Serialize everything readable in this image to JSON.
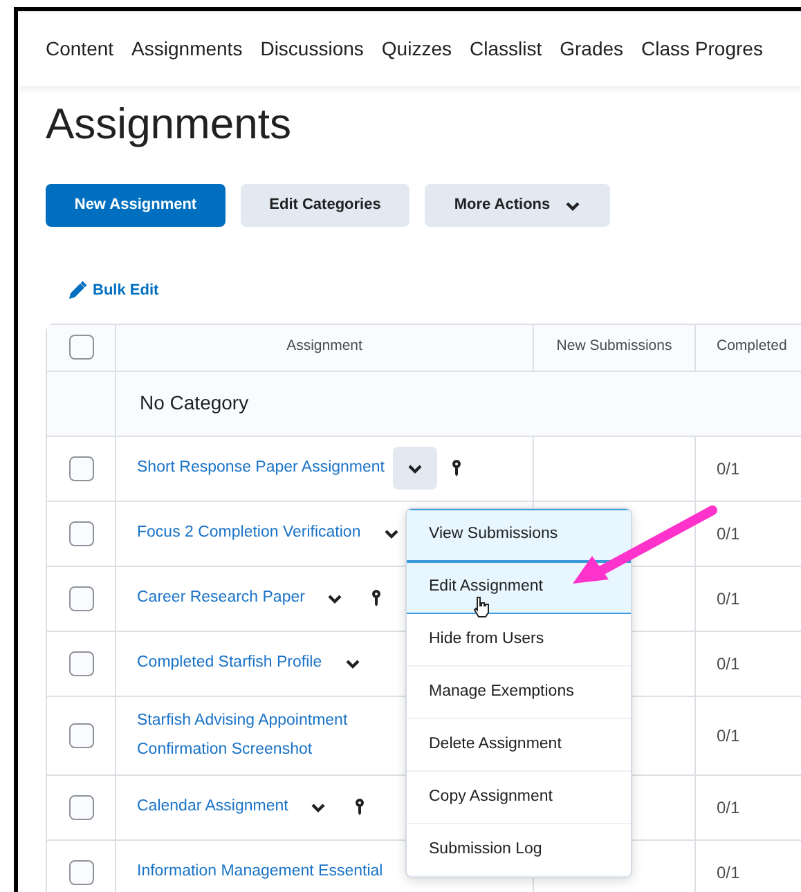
{
  "nav": {
    "items": [
      "Content",
      "Assignments",
      "Discussions",
      "Quizzes",
      "Classlist",
      "Grades",
      "Class Progres"
    ]
  },
  "title": "Assignments",
  "actions": [
    {
      "label": "New Assignment",
      "kind": "primary"
    },
    {
      "label": "Edit Categories",
      "kind": "secondary"
    },
    {
      "label": "More Actions",
      "kind": "dropdown"
    }
  ],
  "bulk_edit": "Bulk Edit",
  "table": {
    "columns": [
      "Assignment",
      "New Submissions",
      "Completed"
    ],
    "header_checked": false,
    "category": "No Category",
    "rows": [
      {
        "name": "Short Response Paper Assignment",
        "completed": "0/1",
        "checked": false,
        "menu_button": true,
        "expanded": true,
        "key": true
      },
      {
        "name": "Focus 2 Completion Verification",
        "completed": "0/1",
        "checked": false,
        "menu_button": true,
        "expanded": false,
        "key": false
      },
      {
        "name": "Career Research Paper",
        "completed": "0/1",
        "checked": false,
        "menu_button": true,
        "expanded": false,
        "key": true
      },
      {
        "name": "Completed Starfish Profile",
        "completed": "0/1",
        "checked": false,
        "menu_button": true,
        "expanded": false,
        "key": false
      },
      {
        "name": "Starfish Advising Appointment Confirmation Screenshot",
        "completed": "0/1",
        "checked": false,
        "menu_button": false,
        "key": false
      },
      {
        "name": "Calendar Assignment",
        "completed": "0/1",
        "checked": false,
        "menu_button": true,
        "expanded": false,
        "key": true
      },
      {
        "name": "Information Management Essential",
        "completed": "0/1",
        "checked": false,
        "menu_button": false,
        "key": false
      }
    ]
  },
  "context_menu": {
    "items": [
      {
        "label": "View Submissions",
        "highlighted": true
      },
      {
        "label": "Edit Assignment",
        "highlighted": true
      },
      {
        "label": "Hide from Users",
        "highlighted": false
      },
      {
        "label": "Manage Exemptions",
        "highlighted": false
      },
      {
        "label": "Delete Assignment",
        "highlighted": false
      },
      {
        "label": "Copy Assignment",
        "highlighted": false
      },
      {
        "label": "Submission Log",
        "highlighted": false
      }
    ]
  },
  "annotation": {
    "kind": "arrow",
    "color": "#ff33cc"
  }
}
